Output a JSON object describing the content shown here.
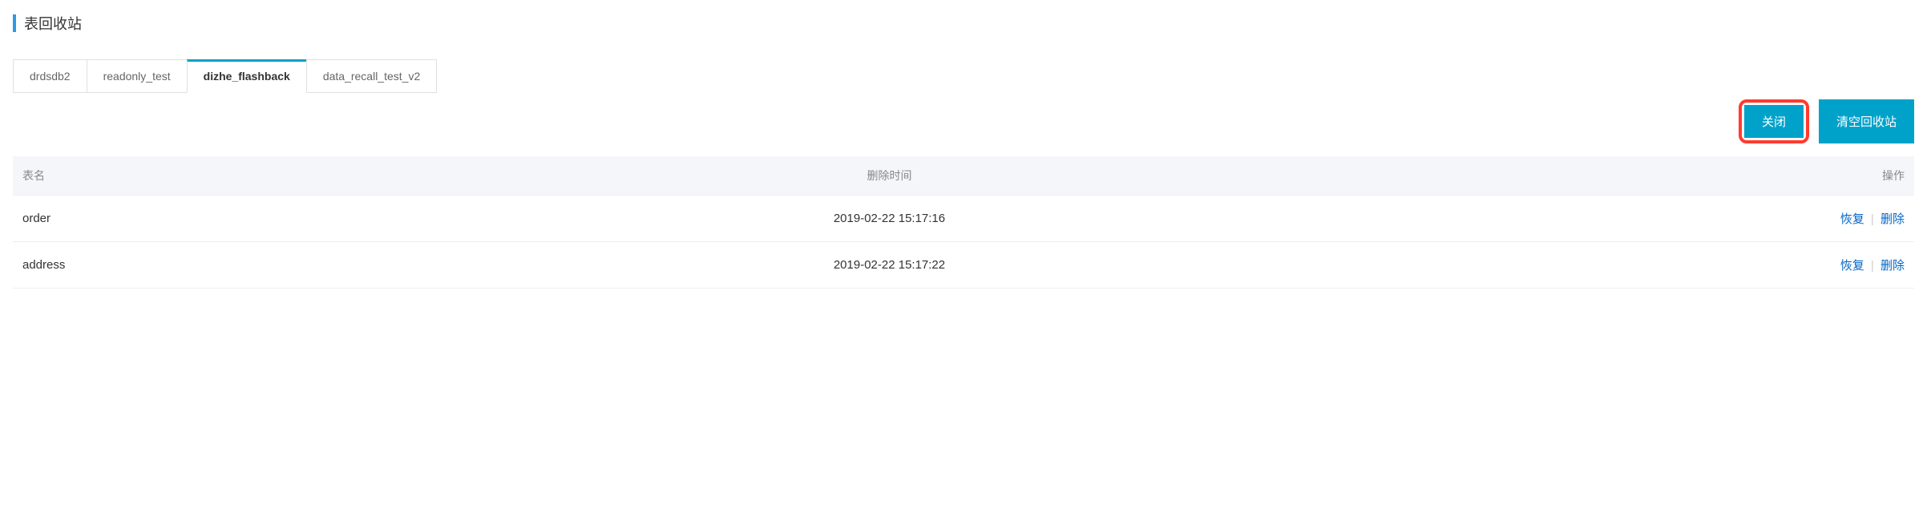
{
  "page": {
    "title": "表回收站"
  },
  "tabs": {
    "items": [
      {
        "label": "drdsdb2",
        "active": false
      },
      {
        "label": "readonly_test",
        "active": false
      },
      {
        "label": "dizhe_flashback",
        "active": true
      },
      {
        "label": "data_recall_test_v2",
        "active": false
      }
    ]
  },
  "actions": {
    "close_label": "关闭",
    "empty_label": "清空回收站"
  },
  "table": {
    "columns": {
      "name": "表名",
      "deleted_at": "删除时间",
      "ops": "操作"
    },
    "rows": [
      {
        "name": "order",
        "deleted_at": "2019-02-22 15:17:16"
      },
      {
        "name": "address",
        "deleted_at": "2019-02-22 15:17:22"
      }
    ],
    "ops": {
      "restore_label": "恢复",
      "delete_label": "删除"
    }
  }
}
